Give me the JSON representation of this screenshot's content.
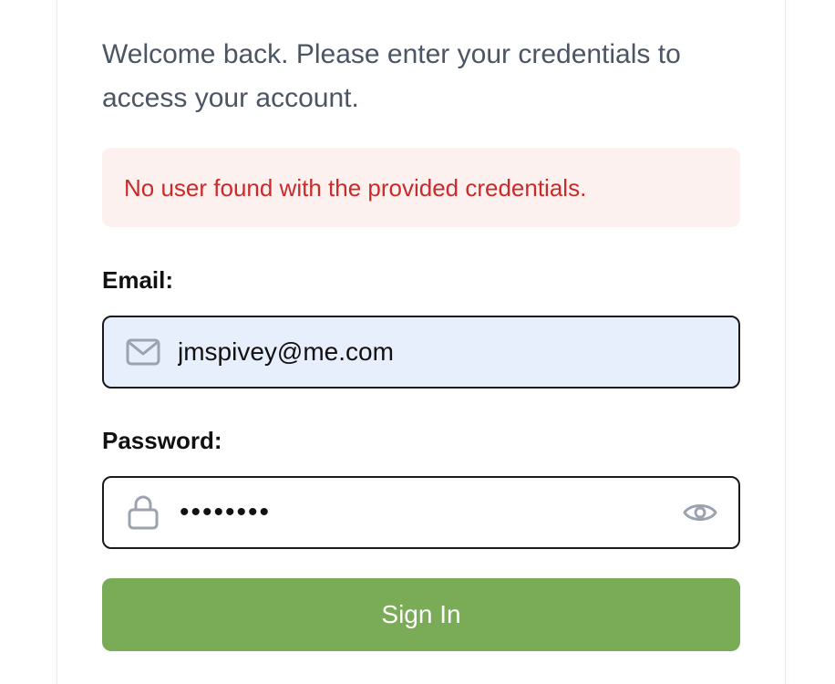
{
  "intro": {
    "text": "Welcome back. Please enter your credentials to access your account."
  },
  "alert": {
    "message": "No user found with the provided credentials.",
    "background": "#fdf1f0",
    "color": "#c92a2a"
  },
  "email": {
    "label": "Email:",
    "value": "jmspivey@me.com",
    "icon": "envelope-icon",
    "background": "#e8effc"
  },
  "password": {
    "label": "Password:",
    "value": "********",
    "icon": "lock-icon",
    "toggle_icon": "eye-icon"
  },
  "signin": {
    "label": "Sign In",
    "background": "#7aab57"
  },
  "colors": {
    "icon_gray": "#9ca3af",
    "text_dark": "#111111",
    "text_muted": "#4b5563"
  }
}
